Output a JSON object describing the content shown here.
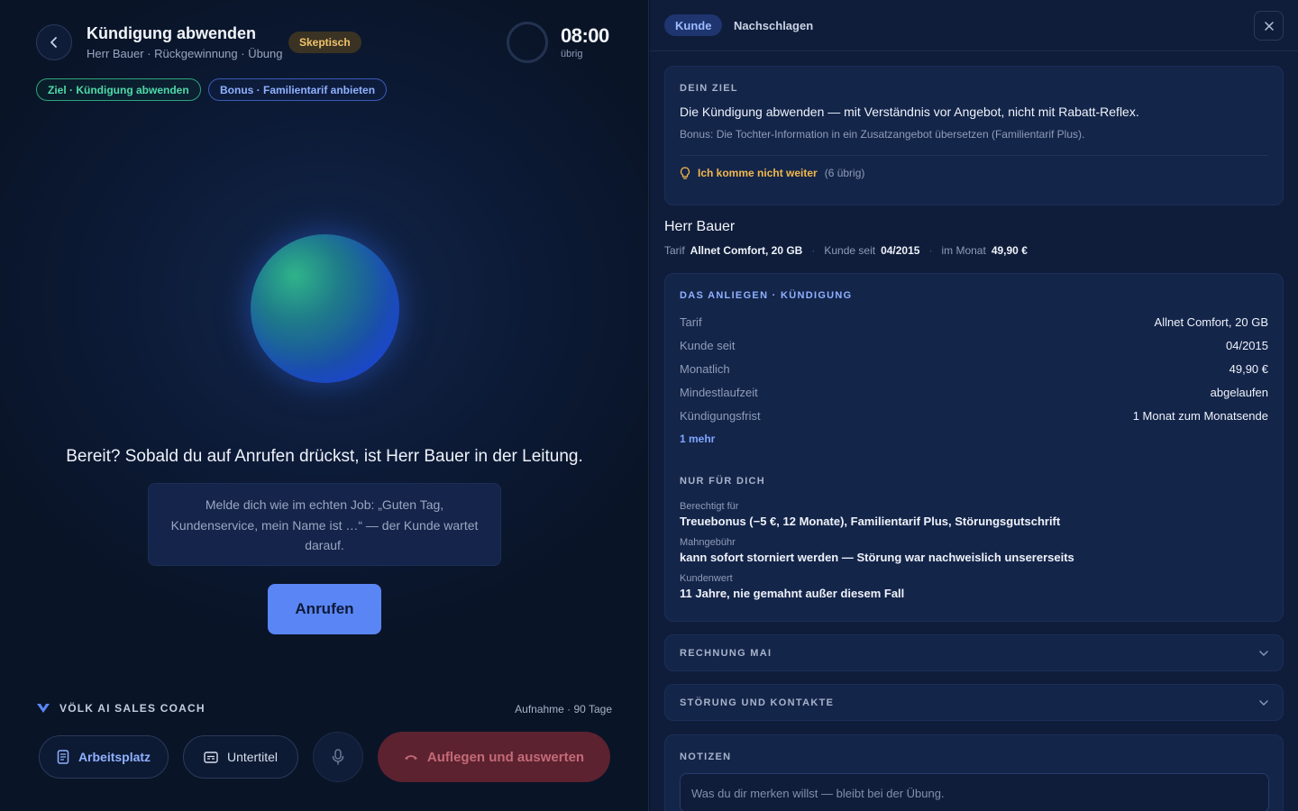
{
  "header": {
    "title": "Kündigung abwenden",
    "subtitle": "Herr Bauer · Rückgewinnung · Übung",
    "mood": "Skeptisch",
    "timer": "08:00",
    "timer_label": "übrig"
  },
  "chips": {
    "goal": "Ziel · Kündigung abwenden",
    "bonus": "Bonus · Familientarif anbieten"
  },
  "call": {
    "ready_text": "Bereit? Sobald du auf Anrufen drückst, ist Herr Bauer in der Leitung.",
    "hint": "Melde dich wie im echten Job: „Guten Tag, Kundenservice, mein Name ist …“ — der Kunde wartet darauf.",
    "call_label": "Anrufen"
  },
  "footer": {
    "brand": "VÖLK AI SALES COACH",
    "recording": "Aufnahme · 90 Tage",
    "workplace_label": "Arbeitsplatz",
    "subtitles_label": "Untertitel",
    "hangup_label": "Auflegen und auswerten"
  },
  "panel": {
    "tabs": [
      {
        "label": "Kunde",
        "active": true
      },
      {
        "label": "Nachschlagen",
        "active": false
      }
    ],
    "goal_card": {
      "title": "DEIN ZIEL",
      "main": "Die Kündigung abwenden — mit Verständnis vor Angebot, nicht mit Rabatt-Reflex.",
      "bonus": "Bonus: Die Tochter-Information in ein Zusatzangebot übersetzen (Familientarif Plus).",
      "stuck_link": "Ich komme nicht weiter",
      "stuck_count": "(6 übrig)"
    },
    "customer": {
      "name": "Herr Bauer",
      "tariff_label": "Tarif",
      "tariff": "Allnet Comfort, 20 GB",
      "since_label": "Kunde seit",
      "since": "04/2015",
      "monthly_label": "im Monat",
      "monthly": "49,90 €"
    },
    "concern": {
      "title": "DAS ANLIEGEN · KÜNDIGUNG",
      "rows": [
        {
          "key": "Tarif",
          "value": "Allnet Comfort, 20 GB"
        },
        {
          "key": "Kunde seit",
          "value": "04/2015"
        },
        {
          "key": "Monatlich",
          "value": "49,90 €"
        },
        {
          "key": "Mindestlaufzeit",
          "value": "abgelaufen"
        },
        {
          "key": "Kündigungsfrist",
          "value": "1 Monat zum Monatsende"
        }
      ],
      "more": "1 mehr",
      "only_you_title": "NUR FÜR DICH",
      "notes": [
        {
          "label": "Berechtigt für",
          "value": "Treuebonus (−5 €, 12 Monate), Familientarif Plus, Störungsgutschrift"
        },
        {
          "label": "Mahngebühr",
          "value": "kann sofort storniert werden — Störung war nachweislich unsererseits"
        },
        {
          "label": "Kundenwert",
          "value": "11 Jahre, nie gemahnt außer diesem Fall"
        }
      ]
    },
    "sections": {
      "invoice": "RECHNUNG MAI",
      "outage": "STÖRUNG UND KONTAKTE"
    },
    "notes": {
      "title": "NOTIZEN",
      "placeholder": "Was du dir merken willst — bleibt bei der Übung."
    }
  },
  "colors": {
    "accent": "#5a86f5",
    "goal_green": "#4fd9a8",
    "warning_amber": "#f2b84b",
    "hangup_red": "#5c2230"
  }
}
